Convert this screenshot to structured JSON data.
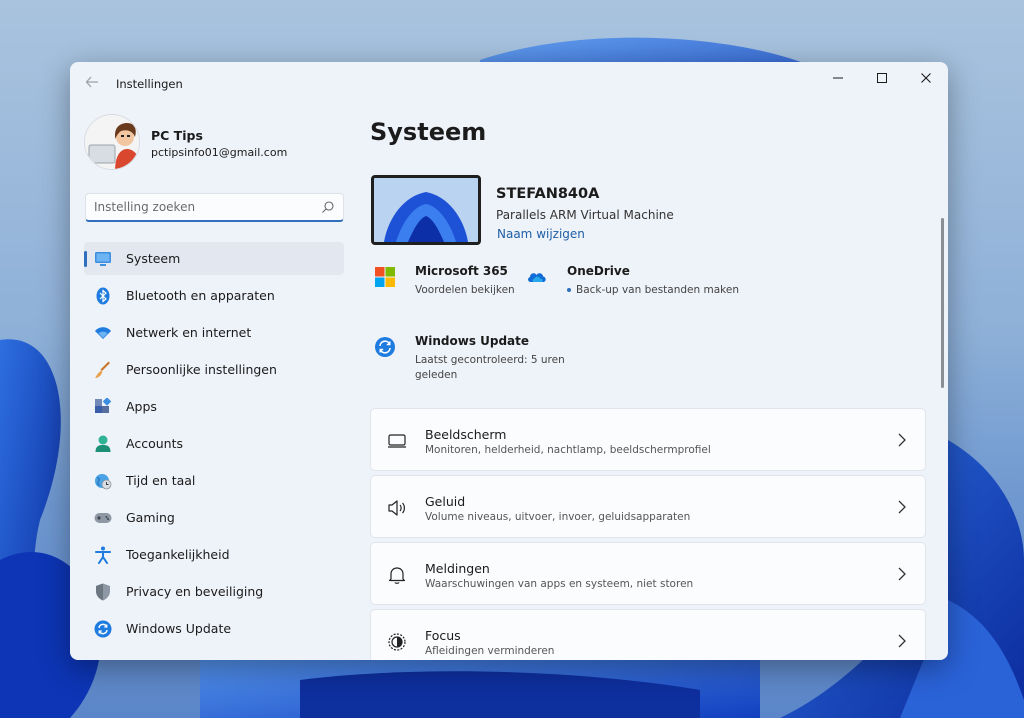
{
  "window": {
    "title": "Instellingen",
    "controls": {
      "minimize": "minimize",
      "maximize": "maximize",
      "close": "close"
    }
  },
  "profile": {
    "name": "PC Tips",
    "email": "pctipsinfo01@gmail.com"
  },
  "search": {
    "placeholder": "Instelling zoeken"
  },
  "sidebar": {
    "items": [
      {
        "label": "Systeem",
        "icon": "monitor-icon",
        "active": true
      },
      {
        "label": "Bluetooth en apparaten",
        "icon": "bluetooth-icon"
      },
      {
        "label": "Netwerk en internet",
        "icon": "wifi-icon"
      },
      {
        "label": "Persoonlijke instellingen",
        "icon": "brush-icon"
      },
      {
        "label": "Apps",
        "icon": "apps-icon"
      },
      {
        "label": "Accounts",
        "icon": "person-icon"
      },
      {
        "label": "Tijd en taal",
        "icon": "globe-clock-icon"
      },
      {
        "label": "Gaming",
        "icon": "gamepad-icon"
      },
      {
        "label": "Toegankelijkheid",
        "icon": "accessibility-icon"
      },
      {
        "label": "Privacy en beveiliging",
        "icon": "shield-icon"
      },
      {
        "label": "Windows Update",
        "icon": "update-icon"
      }
    ]
  },
  "main": {
    "title": "Systeem",
    "device": {
      "name": "STEFAN840A",
      "model": "Parallels ARM Virtual Machine",
      "rename_label": "Naam wijzigen"
    },
    "quick": {
      "microsoft365": {
        "title": "Microsoft 365",
        "subtitle": "Voordelen bekijken"
      },
      "onedrive": {
        "title": "OneDrive",
        "subtitle": "Back-up van bestanden maken"
      },
      "windows_update": {
        "title": "Windows Update",
        "subtitle_line1": "Laatst gecontroleerd: 5 uren",
        "subtitle_line2": "geleden"
      }
    },
    "cards": [
      {
        "title": "Beeldscherm",
        "subtitle": "Monitoren, helderheid, nachtlamp, beeldschermprofiel",
        "icon": "display-icon"
      },
      {
        "title": "Geluid",
        "subtitle": "Volume niveaus, uitvoer, invoer, geluidsapparaten",
        "icon": "speaker-icon"
      },
      {
        "title": "Meldingen",
        "subtitle": "Waarschuwingen van apps en systeem, niet storen",
        "icon": "bell-icon"
      },
      {
        "title": "Focus",
        "subtitle": "Afleidingen verminderen",
        "icon": "focus-icon"
      }
    ]
  },
  "colors": {
    "accent": "#2f6fbd",
    "window_bg": "#eef2f9",
    "card_bg": "#fbfcfe",
    "link": "#1f5fa6"
  }
}
